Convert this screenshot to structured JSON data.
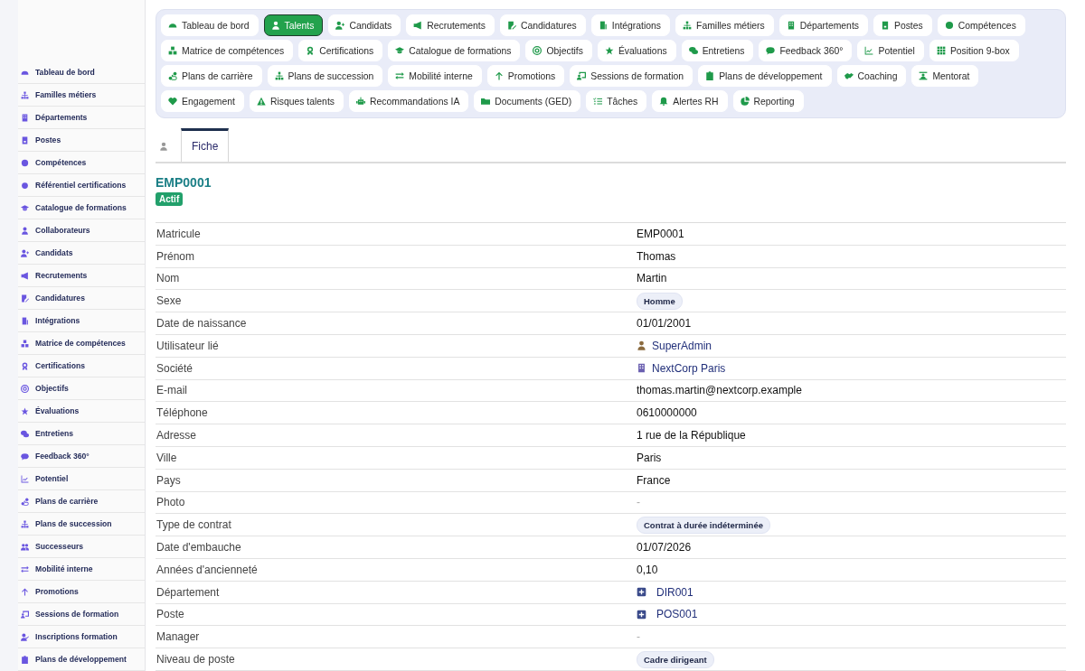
{
  "sidebar": {
    "items": [
      {
        "label": "Tableau de bord"
      },
      {
        "label": "Familles métiers"
      },
      {
        "label": "Départements"
      },
      {
        "label": "Postes"
      },
      {
        "label": "Compétences"
      },
      {
        "label": "Référentiel certifications"
      },
      {
        "label": "Catalogue de formations"
      },
      {
        "label": "Collaborateurs"
      },
      {
        "label": "Candidats"
      },
      {
        "label": "Recrutements"
      },
      {
        "label": "Candidatures"
      },
      {
        "label": "Intégrations"
      },
      {
        "label": "Matrice de compétences"
      },
      {
        "label": "Certifications"
      },
      {
        "label": "Objectifs"
      },
      {
        "label": "Évaluations"
      },
      {
        "label": "Entretiens"
      },
      {
        "label": "Feedback 360°"
      },
      {
        "label": "Potentiel"
      },
      {
        "label": "Plans de carrière"
      },
      {
        "label": "Plans de succession"
      },
      {
        "label": "Successeurs"
      },
      {
        "label": "Mobilité interne"
      },
      {
        "label": "Promotions"
      },
      {
        "label": "Sessions de formation"
      },
      {
        "label": "Inscriptions formation"
      },
      {
        "label": "Plans de développement"
      }
    ]
  },
  "top_nav": {
    "tabs": [
      {
        "label": "Tableau de bord",
        "selected": false
      },
      {
        "label": "Talents",
        "selected": true
      },
      {
        "label": "Candidats",
        "selected": false
      },
      {
        "label": "Recrutements",
        "selected": false
      },
      {
        "label": "Candidatures",
        "selected": false
      },
      {
        "label": "Intégrations",
        "selected": false
      },
      {
        "label": "Familles métiers",
        "selected": false
      },
      {
        "label": "Départements",
        "selected": false
      },
      {
        "label": "Postes",
        "selected": false
      },
      {
        "label": "Compétences",
        "selected": false
      },
      {
        "label": "Matrice de compétences",
        "selected": false
      },
      {
        "label": "Certifications",
        "selected": false
      },
      {
        "label": "Catalogue de formations",
        "selected": false
      },
      {
        "label": "Objectifs",
        "selected": false
      },
      {
        "label": "Évaluations",
        "selected": false
      },
      {
        "label": "Entretiens",
        "selected": false
      },
      {
        "label": "Feedback 360°",
        "selected": false
      },
      {
        "label": "Potentiel",
        "selected": false
      },
      {
        "label": "Position 9-box",
        "selected": false
      },
      {
        "label": "Plans de carrière",
        "selected": false
      },
      {
        "label": "Plans de succession",
        "selected": false
      },
      {
        "label": "Mobilité interne",
        "selected": false
      },
      {
        "label": "Promotions",
        "selected": false
      },
      {
        "label": "Sessions de formation",
        "selected": false
      },
      {
        "label": "Plans de développement",
        "selected": false
      },
      {
        "label": "Coaching",
        "selected": false
      },
      {
        "label": "Mentorat",
        "selected": false
      },
      {
        "label": "Engagement",
        "selected": false
      },
      {
        "label": "Risques talents",
        "selected": false
      },
      {
        "label": "Recommandations IA",
        "selected": false
      },
      {
        "label": "Documents (GED)",
        "selected": false
      },
      {
        "label": "Tâches",
        "selected": false
      },
      {
        "label": "Alertes RH",
        "selected": false
      },
      {
        "label": "Reporting",
        "selected": false
      }
    ]
  },
  "record_tabs": [
    {
      "label": "Fiche",
      "selected": true
    }
  ],
  "record": {
    "code": "EMP0001",
    "status": "Actif"
  },
  "fields": [
    {
      "label": "Matricule",
      "value": "EMP0001",
      "kind": "text"
    },
    {
      "label": "Prénom",
      "value": "Thomas",
      "kind": "text"
    },
    {
      "label": "Nom",
      "value": "Martin",
      "kind": "text"
    },
    {
      "label": "Sexe",
      "value": "Homme",
      "kind": "badge"
    },
    {
      "label": "Date de naissance",
      "value": "01/01/2001",
      "kind": "text"
    },
    {
      "label": "Utilisateur lié",
      "value": "SuperAdmin",
      "kind": "user_link"
    },
    {
      "label": "Société",
      "value": "NextCorp Paris",
      "kind": "company_link"
    },
    {
      "label": "E-mail",
      "value": "thomas.martin@nextcorp.example",
      "kind": "text"
    },
    {
      "label": "Téléphone",
      "value": "0610000000",
      "kind": "text"
    },
    {
      "label": "Adresse",
      "value": "1 rue de la République",
      "kind": "text"
    },
    {
      "label": "Ville",
      "value": "Paris",
      "kind": "text"
    },
    {
      "label": "Pays",
      "value": "France",
      "kind": "text"
    },
    {
      "label": "Photo",
      "value": "-",
      "kind": "empty"
    },
    {
      "label": "Type de contrat",
      "value": "Contrat à durée indéterminée",
      "kind": "badge"
    },
    {
      "label": "Date d'embauche",
      "value": "01/07/2026",
      "kind": "text"
    },
    {
      "label": "Années d'ancienneté",
      "value": "0,10",
      "kind": "text"
    },
    {
      "label": "Département",
      "value": "DIR001",
      "kind": "record_link"
    },
    {
      "label": "Poste",
      "value": "POS001",
      "kind": "record_link"
    },
    {
      "label": "Manager",
      "value": "-",
      "kind": "empty"
    },
    {
      "label": "Niveau de poste",
      "value": "Cadre dirigeant",
      "kind": "badge"
    }
  ]
}
